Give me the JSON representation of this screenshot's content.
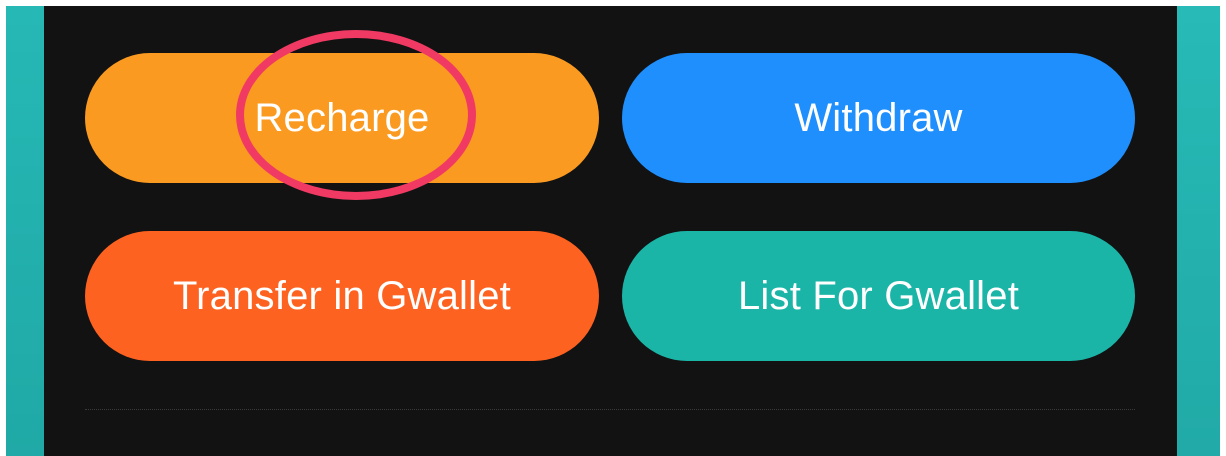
{
  "actions": {
    "recharge": {
      "label": "Recharge",
      "color": "#fa9a20"
    },
    "withdraw": {
      "label": "Withdraw",
      "color": "#1e8ffd"
    },
    "transfer": {
      "label": "Transfer in Gwallet",
      "color": "#fd6220"
    },
    "list": {
      "label": "List For Gwallet",
      "color": "#1bb5a8"
    }
  },
  "annotation": {
    "highlight_color": "#f03a63",
    "highlighted": "Recharge"
  },
  "theme": {
    "panel_background": "#121212",
    "side_accent": "#24b3b0"
  }
}
